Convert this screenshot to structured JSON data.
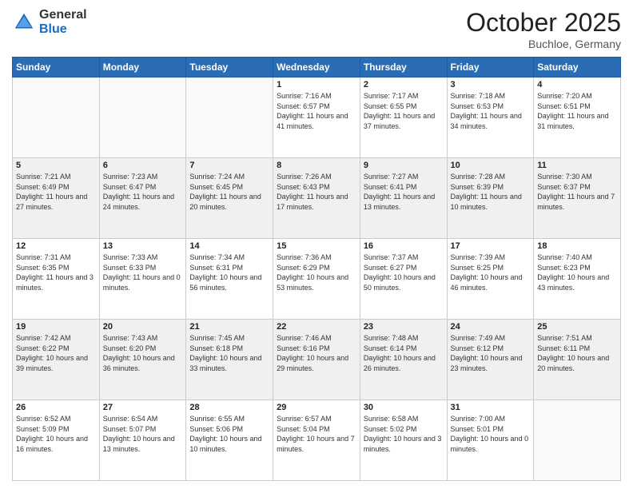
{
  "logo": {
    "general": "General",
    "blue": "Blue"
  },
  "header": {
    "month": "October 2025",
    "location": "Buchloe, Germany"
  },
  "weekdays": [
    "Sunday",
    "Monday",
    "Tuesday",
    "Wednesday",
    "Thursday",
    "Friday",
    "Saturday"
  ],
  "weeks": [
    [
      {
        "day": "",
        "info": ""
      },
      {
        "day": "",
        "info": ""
      },
      {
        "day": "",
        "info": ""
      },
      {
        "day": "1",
        "info": "Sunrise: 7:16 AM\nSunset: 6:57 PM\nDaylight: 11 hours and 41 minutes."
      },
      {
        "day": "2",
        "info": "Sunrise: 7:17 AM\nSunset: 6:55 PM\nDaylight: 11 hours and 37 minutes."
      },
      {
        "day": "3",
        "info": "Sunrise: 7:18 AM\nSunset: 6:53 PM\nDaylight: 11 hours and 34 minutes."
      },
      {
        "day": "4",
        "info": "Sunrise: 7:20 AM\nSunset: 6:51 PM\nDaylight: 11 hours and 31 minutes."
      }
    ],
    [
      {
        "day": "5",
        "info": "Sunrise: 7:21 AM\nSunset: 6:49 PM\nDaylight: 11 hours and 27 minutes."
      },
      {
        "day": "6",
        "info": "Sunrise: 7:23 AM\nSunset: 6:47 PM\nDaylight: 11 hours and 24 minutes."
      },
      {
        "day": "7",
        "info": "Sunrise: 7:24 AM\nSunset: 6:45 PM\nDaylight: 11 hours and 20 minutes."
      },
      {
        "day": "8",
        "info": "Sunrise: 7:26 AM\nSunset: 6:43 PM\nDaylight: 11 hours and 17 minutes."
      },
      {
        "day": "9",
        "info": "Sunrise: 7:27 AM\nSunset: 6:41 PM\nDaylight: 11 hours and 13 minutes."
      },
      {
        "day": "10",
        "info": "Sunrise: 7:28 AM\nSunset: 6:39 PM\nDaylight: 11 hours and 10 minutes."
      },
      {
        "day": "11",
        "info": "Sunrise: 7:30 AM\nSunset: 6:37 PM\nDaylight: 11 hours and 7 minutes."
      }
    ],
    [
      {
        "day": "12",
        "info": "Sunrise: 7:31 AM\nSunset: 6:35 PM\nDaylight: 11 hours and 3 minutes."
      },
      {
        "day": "13",
        "info": "Sunrise: 7:33 AM\nSunset: 6:33 PM\nDaylight: 11 hours and 0 minutes."
      },
      {
        "day": "14",
        "info": "Sunrise: 7:34 AM\nSunset: 6:31 PM\nDaylight: 10 hours and 56 minutes."
      },
      {
        "day": "15",
        "info": "Sunrise: 7:36 AM\nSunset: 6:29 PM\nDaylight: 10 hours and 53 minutes."
      },
      {
        "day": "16",
        "info": "Sunrise: 7:37 AM\nSunset: 6:27 PM\nDaylight: 10 hours and 50 minutes."
      },
      {
        "day": "17",
        "info": "Sunrise: 7:39 AM\nSunset: 6:25 PM\nDaylight: 10 hours and 46 minutes."
      },
      {
        "day": "18",
        "info": "Sunrise: 7:40 AM\nSunset: 6:23 PM\nDaylight: 10 hours and 43 minutes."
      }
    ],
    [
      {
        "day": "19",
        "info": "Sunrise: 7:42 AM\nSunset: 6:22 PM\nDaylight: 10 hours and 39 minutes."
      },
      {
        "day": "20",
        "info": "Sunrise: 7:43 AM\nSunset: 6:20 PM\nDaylight: 10 hours and 36 minutes."
      },
      {
        "day": "21",
        "info": "Sunrise: 7:45 AM\nSunset: 6:18 PM\nDaylight: 10 hours and 33 minutes."
      },
      {
        "day": "22",
        "info": "Sunrise: 7:46 AM\nSunset: 6:16 PM\nDaylight: 10 hours and 29 minutes."
      },
      {
        "day": "23",
        "info": "Sunrise: 7:48 AM\nSunset: 6:14 PM\nDaylight: 10 hours and 26 minutes."
      },
      {
        "day": "24",
        "info": "Sunrise: 7:49 AM\nSunset: 6:12 PM\nDaylight: 10 hours and 23 minutes."
      },
      {
        "day": "25",
        "info": "Sunrise: 7:51 AM\nSunset: 6:11 PM\nDaylight: 10 hours and 20 minutes."
      }
    ],
    [
      {
        "day": "26",
        "info": "Sunrise: 6:52 AM\nSunset: 5:09 PM\nDaylight: 10 hours and 16 minutes."
      },
      {
        "day": "27",
        "info": "Sunrise: 6:54 AM\nSunset: 5:07 PM\nDaylight: 10 hours and 13 minutes."
      },
      {
        "day": "28",
        "info": "Sunrise: 6:55 AM\nSunset: 5:06 PM\nDaylight: 10 hours and 10 minutes."
      },
      {
        "day": "29",
        "info": "Sunrise: 6:57 AM\nSunset: 5:04 PM\nDaylight: 10 hours and 7 minutes."
      },
      {
        "day": "30",
        "info": "Sunrise: 6:58 AM\nSunset: 5:02 PM\nDaylight: 10 hours and 3 minutes."
      },
      {
        "day": "31",
        "info": "Sunrise: 7:00 AM\nSunset: 5:01 PM\nDaylight: 10 hours and 0 minutes."
      },
      {
        "day": "",
        "info": ""
      }
    ]
  ]
}
